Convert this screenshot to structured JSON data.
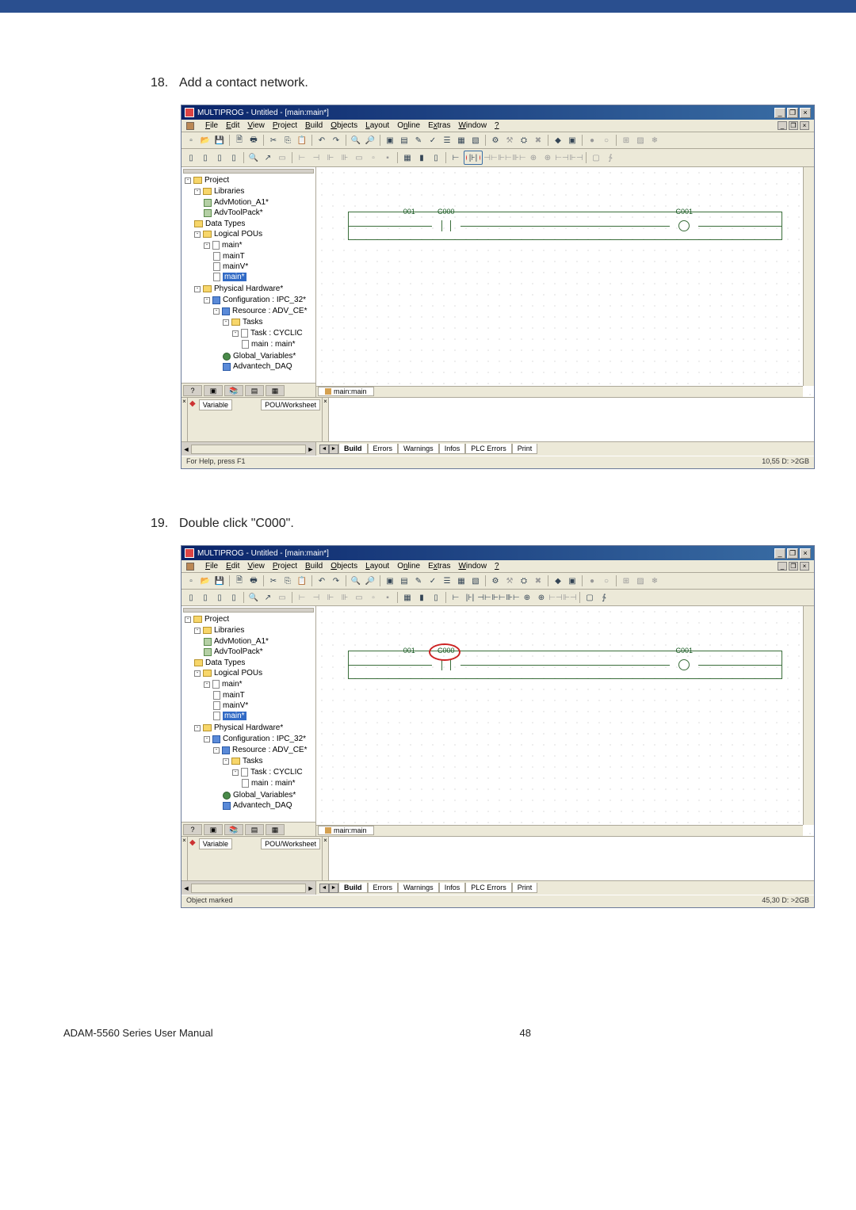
{
  "steps": {
    "s18_num": "18.",
    "s18_text": "Add a contact network.",
    "s19_num": "19.",
    "s19_text": "Double click \"C000\"."
  },
  "app": {
    "title": "MULTIPROG - Untitled - [main:main*]",
    "menus": [
      "File",
      "Edit",
      "View",
      "Project",
      "Build",
      "Objects",
      "Layout",
      "Online",
      "Extras",
      "Window",
      "?"
    ],
    "tree": {
      "root": "Project",
      "libraries": "Libraries",
      "lib1": "AdvMotion_A1*",
      "lib2": "AdvToolPack*",
      "dtypes": "Data Types",
      "lpous": "Logical POUs",
      "main": "main*",
      "mainT": "mainT",
      "mainV": "mainV*",
      "mainS": "main*",
      "phw": "Physical Hardware*",
      "config": "Configuration : IPC_32*",
      "resource": "Resource : ADV_CE*",
      "tasks": "Tasks",
      "task": "Task : CYCLIC",
      "taskmain": "main : main*",
      "globals": "Global_Variables*",
      "adv": "Advantech_DAQ"
    },
    "rung": {
      "l1": "001",
      "c": "C000",
      "c1": "C001"
    },
    "canvas_tab": "main:main",
    "var": {
      "variable": "Variable",
      "pou": "POU/Worksheet"
    },
    "bottom_tabs": [
      "Build",
      "Errors",
      "Warnings",
      "Infos",
      "PLC Errors",
      "Print"
    ],
    "status1": {
      "left": "For Help, press F1",
      "right": "10,55  D: >2GB"
    },
    "status2": {
      "left": "Object marked",
      "right": "45,30  D: >2GB"
    }
  },
  "footer": {
    "left": "ADAM-5560 Series User Manual",
    "page": "48"
  }
}
